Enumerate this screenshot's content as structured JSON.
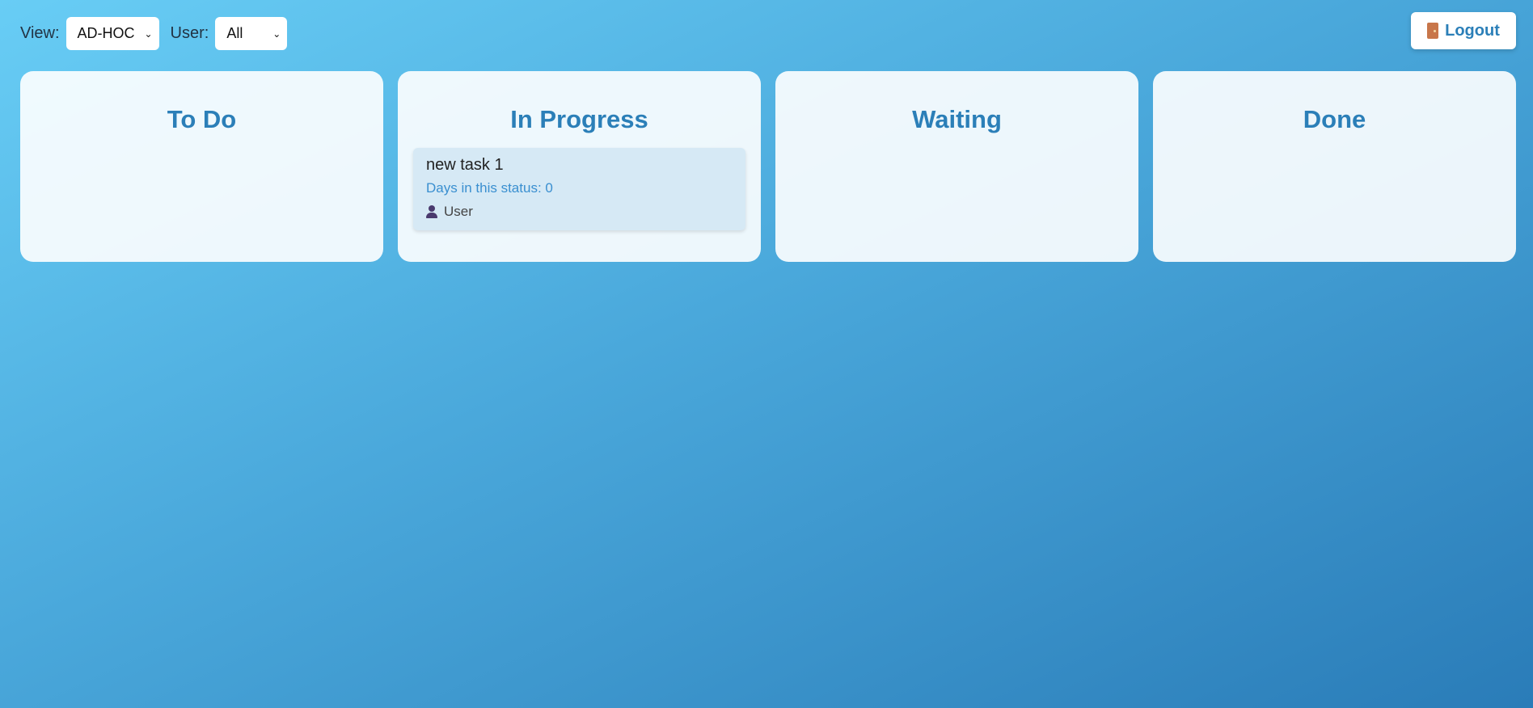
{
  "filters": {
    "view_label": "View:",
    "view_value": "AD-HOC",
    "user_label": "User:",
    "user_value": "All"
  },
  "logout": {
    "label": "Logout",
    "icon": "door-icon"
  },
  "columns": [
    {
      "title": "To Do",
      "cards": []
    },
    {
      "title": "In Progress",
      "cards": [
        {
          "title": "new task 1",
          "days": "Days in this status: 0",
          "user": "User",
          "icon": "user-icon"
        }
      ]
    },
    {
      "title": "Waiting",
      "cards": []
    },
    {
      "title": "Done",
      "cards": []
    }
  ],
  "colors": {
    "accent": "#2b7fb8",
    "days_text": "#3a8fd0",
    "card_bg": "#d6e9f5",
    "background_start": "#68cdf5",
    "background_end": "#2a7cb8"
  }
}
